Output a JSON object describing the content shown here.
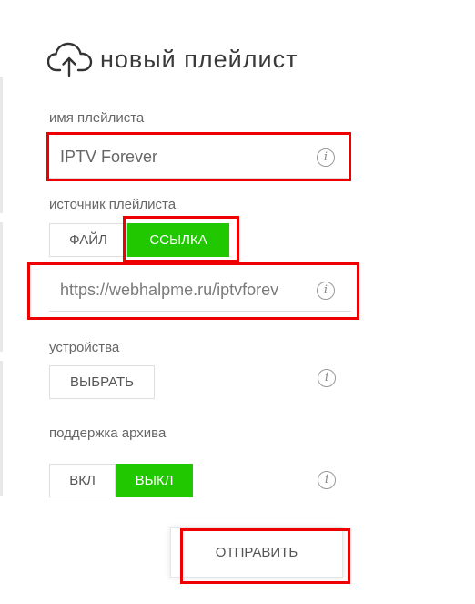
{
  "header": {
    "title": "новый плейлист",
    "icon": "cloud-upload-icon"
  },
  "form": {
    "name": {
      "label": "имя плейлиста",
      "value": "IPTV Forever"
    },
    "source": {
      "label": "источник плейлиста",
      "file_label": "ФАЙЛ",
      "link_label": "ССЫЛКА",
      "selected": "ССЫЛКА",
      "url_value": "https://webhalpme.ru/iptvforev"
    },
    "devices": {
      "label": "устройства",
      "choose_label": "ВЫБРАТЬ"
    },
    "archive": {
      "label": "поддержка архива",
      "on_label": "ВКЛ",
      "off_label": "ВЫКЛ",
      "selected": "ВЫКЛ"
    },
    "submit_label": "ОТПРАВИТЬ",
    "info_glyph": "i"
  },
  "colors": {
    "accent": "#21c800",
    "highlight": "#ee0000",
    "text": "#555555"
  }
}
